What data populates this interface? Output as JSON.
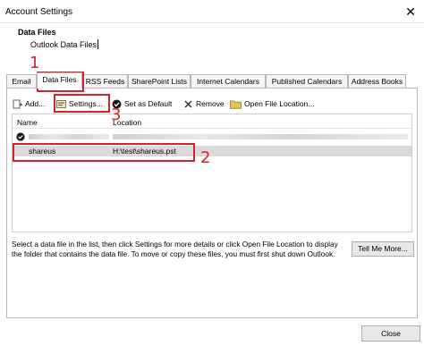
{
  "window": {
    "title": "Account Settings",
    "close_glyph": "✕"
  },
  "header": {
    "label": "Data Files",
    "sublabel": "Outlook Data Files"
  },
  "tabs": [
    {
      "label": "Email"
    },
    {
      "label": "Data Files"
    },
    {
      "label": "RSS Feeds"
    },
    {
      "label": "SharePoint Lists"
    },
    {
      "label": "Internet Calendars"
    },
    {
      "label": "Published Calendars"
    },
    {
      "label": "Address Books"
    }
  ],
  "toolbar": {
    "add": "Add...",
    "settings": "Settings...",
    "set_default": "Set as Default",
    "remove": "Remove",
    "open_location": "Open File Location..."
  },
  "list": {
    "columns": {
      "name": "Name",
      "location": "Location"
    },
    "rows": [
      {
        "name": "",
        "location": ""
      },
      {
        "name": "shareus",
        "location": "H:\\test\\shareus.pst"
      }
    ]
  },
  "description": "Select a data file in the list, then click Settings for more details or click Open File Location to display the folder that contains the data file. To move or copy these files, you must first shut down Outlook.",
  "buttons": {
    "tell_me_more": "Tell Me More...",
    "close": "Close"
  },
  "annotations": [
    "1",
    "2",
    "3"
  ],
  "colors": {
    "annotation": "#d6202a",
    "selected_row": "#d9d9d9"
  }
}
